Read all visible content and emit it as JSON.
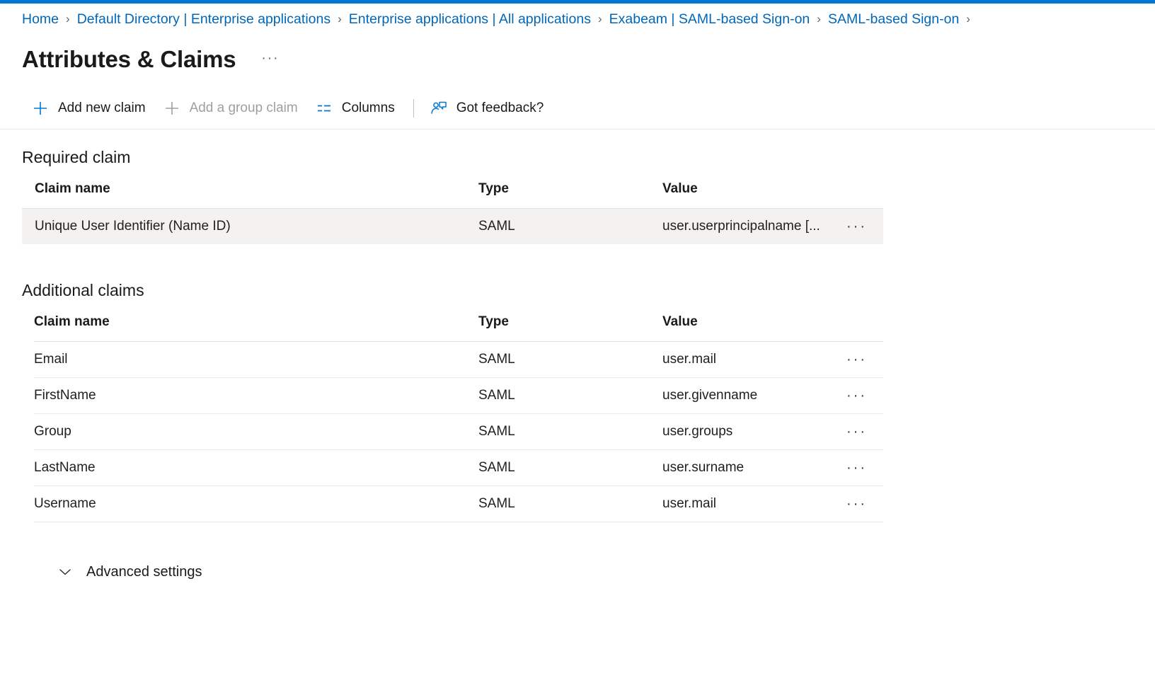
{
  "theme": {
    "accent": "#0078d4",
    "link": "#0067b8",
    "text": "#201f1e",
    "disabled": "#a19f9d",
    "row_highlight": "#f3f2f1"
  },
  "breadcrumb": {
    "separator": "›",
    "items": [
      {
        "label": "Home"
      },
      {
        "label": "Default Directory | Enterprise applications"
      },
      {
        "label": "Enterprise applications | All applications"
      },
      {
        "label": "Exabeam | SAML-based Sign-on"
      },
      {
        "label": "SAML-based Sign-on"
      }
    ],
    "trailing_separator": "›"
  },
  "header": {
    "title": "Attributes & Claims",
    "more_menu": "···"
  },
  "toolbar": {
    "add_new_claim": "Add new claim",
    "add_group_claim": "Add a group claim",
    "columns": "Columns",
    "got_feedback": "Got feedback?",
    "icons": {
      "add_new_claim": "plus-icon",
      "add_group_claim": "plus-icon",
      "columns": "columns-icon",
      "got_feedback": "feedback-person-icon"
    }
  },
  "required_section": {
    "heading": "Required claim",
    "columns": [
      "Claim name",
      "Type",
      "Value"
    ],
    "rows": [
      {
        "name": "Unique User Identifier (Name ID)",
        "type": "SAML",
        "value": "user.userprincipalname [...",
        "menu": "···"
      }
    ]
  },
  "additional_section": {
    "heading": "Additional claims",
    "columns": [
      "Claim name",
      "Type",
      "Value"
    ],
    "rows": [
      {
        "name": "Email",
        "type": "SAML",
        "value": "user.mail",
        "menu": "···"
      },
      {
        "name": "FirstName",
        "type": "SAML",
        "value": "user.givenname",
        "menu": "···"
      },
      {
        "name": "Group",
        "type": "SAML",
        "value": "user.groups",
        "menu": "···"
      },
      {
        "name": "LastName",
        "type": "SAML",
        "value": "user.surname",
        "menu": "···"
      },
      {
        "name": "Username",
        "type": "SAML",
        "value": "user.mail",
        "menu": "···"
      }
    ]
  },
  "advanced": {
    "label": "Advanced settings",
    "icon": "chevron-down-icon"
  }
}
